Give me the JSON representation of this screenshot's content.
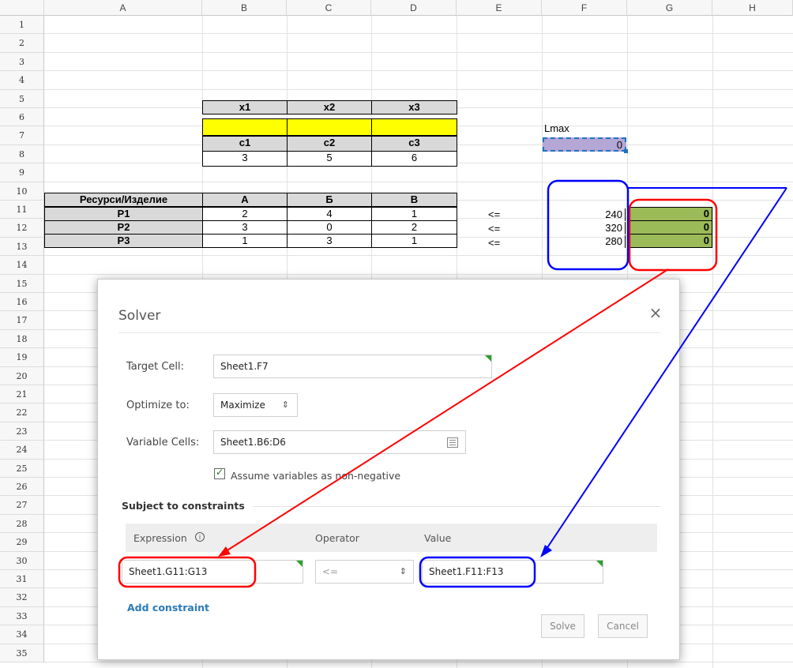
{
  "columns": [
    "A",
    "B",
    "C",
    "D",
    "E",
    "F",
    "G",
    "H"
  ],
  "rows": [
    "1",
    "2",
    "3",
    "4",
    "5",
    "6",
    "7",
    "8",
    "9",
    "10",
    "11",
    "12",
    "13",
    "14",
    "15",
    "16",
    "17",
    "18",
    "19",
    "20",
    "21",
    "22",
    "23",
    "24",
    "25",
    "26",
    "27",
    "28",
    "29",
    "30",
    "31",
    "32",
    "33",
    "34",
    "35"
  ],
  "sheet": {
    "x_headers": [
      "x1",
      "x2",
      "x3"
    ],
    "c_headers": [
      "c1",
      "c2",
      "c3"
    ],
    "c_values": [
      "3",
      "5",
      "6"
    ],
    "lmax_label": "Lmax",
    "lmax_value": "0",
    "table_header": [
      "Ресурси/Изделие",
      "А",
      "Б",
      "В"
    ],
    "table_rows": [
      {
        "name": "P1",
        "a": "2",
        "b": "4",
        "c": "1",
        "op": "<=",
        "limit": "240",
        "used": "0"
      },
      {
        "name": "P2",
        "a": "3",
        "b": "0",
        "c": "2",
        "op": "<=",
        "limit": "320",
        "used": "0"
      },
      {
        "name": "P3",
        "a": "1",
        "b": "3",
        "c": "1",
        "op": "<=",
        "limit": "280",
        "used": "0"
      }
    ]
  },
  "dialog": {
    "title": "Solver",
    "close_glyph": "×",
    "target_label": "Target Cell:",
    "target_value": "Sheet1.F7",
    "optimize_label": "Optimize to:",
    "optimize_value": "Maximize",
    "variable_label": "Variable Cells:",
    "variable_value": "Sheet1.B6:D6",
    "nonneg_label": "Assume variables as non-negative",
    "nonneg_checked": true,
    "constraints_heading": "Subject to constraints",
    "col_expression": "Expression",
    "col_operator": "Operator",
    "col_value": "Value",
    "expression_value": "Sheet1.G11:G13",
    "operator_value": "<=",
    "value_value": "Sheet1.F11:F13",
    "add_constraint": "Add constraint",
    "solve": "Solve",
    "cancel": "Cancel"
  },
  "colors": {
    "yellow": "#ffff00",
    "green": "#9bbb59",
    "gray": "#d9d9d9",
    "purple": "#b4a7d6",
    "annotation_red": "#ff0000",
    "annotation_blue": "#0000ff",
    "link_blue": "#2a7ab9"
  }
}
